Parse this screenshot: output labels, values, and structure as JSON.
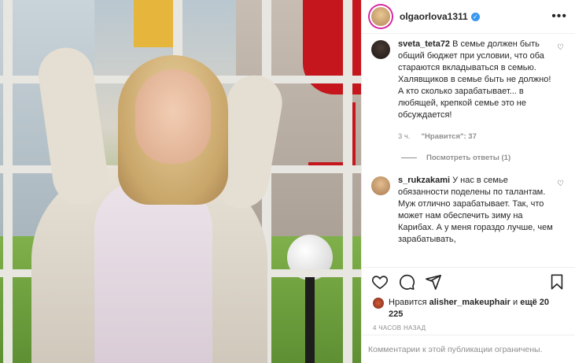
{
  "post": {
    "username": "olgaorlova1311",
    "verified": true,
    "more_label": "•••"
  },
  "comments": [
    {
      "username": "sveta_teta72",
      "text": "В семье должен быть общий бюджет при условии, что оба стараются вкладываться в семью. Халявщиков в семье быть не должно! А кто сколько зарабатывает... в любящей, крепкой семье это не обсуждается!",
      "time": "3 ч.",
      "likes": "\"Нравится\": 37",
      "replies_label": "Посмотреть ответы (1)"
    },
    {
      "username": "s_rukzakami",
      "text": "У нас в семье обязанности поделены по талантам. Муж отлично зарабатывает. Так, что может нам обеспечить зиму на Карибах. А у меня гораздо лучше, чем зарабатывать,"
    }
  ],
  "likes": {
    "prefix": "Нравится",
    "user": "alisher_makeuphair",
    "connector": "и",
    "others": "ещё 20 225"
  },
  "time_ago": "4 ЧАСОВ НАЗАД",
  "footer_text": "Комментарии к этой публикации ограничены.",
  "icons": [
    "heart-icon",
    "comment-icon",
    "share-icon",
    "bookmark-icon",
    "verified-icon",
    "more-icon"
  ],
  "colors": {
    "verified": "#3897f0",
    "meta": "#8e8e8e",
    "text": "#262626"
  }
}
